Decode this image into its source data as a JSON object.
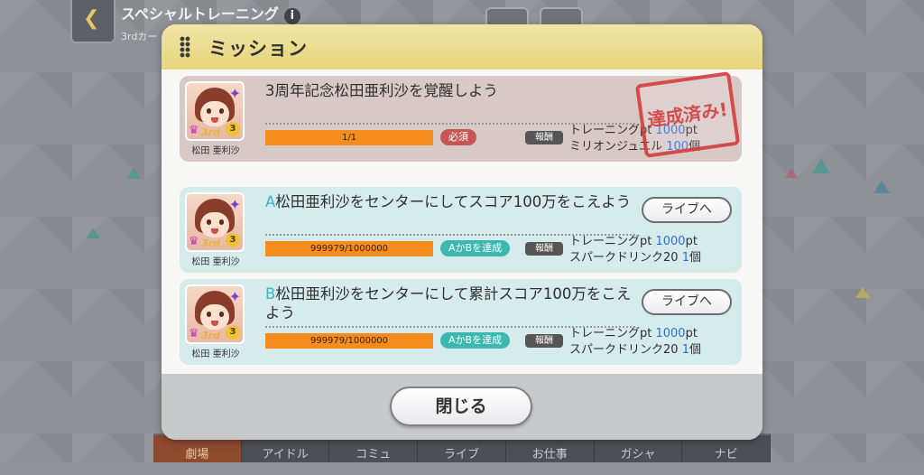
{
  "background": {
    "title": "スペシャルトレーニング",
    "subtitle": "3rdカー",
    "nav": [
      "劇場",
      "アイドル",
      "コミュ",
      "ライブ",
      "お仕事",
      "ガシャ",
      "ナビ"
    ]
  },
  "dialog": {
    "title": "ミッション",
    "close_label": "閉じる",
    "missions": [
      {
        "letter": "",
        "title": "3周年記念松田亜利沙を覚醒しよう",
        "idol_name": "松田 亜利沙",
        "progress_text": "1/1",
        "condition": "必須",
        "reward_label": "報酬",
        "reward_line1_text": "トレーニングpt ",
        "reward_line1_value": "1000",
        "reward_line1_unit": "pt",
        "reward_line2_text": "ミリオンジュエル ",
        "reward_line2_value": "100",
        "reward_line2_unit": "個",
        "stamp": "達成済み!"
      },
      {
        "letter": "A",
        "title": "松田亜利沙をセンターにしてスコア100万をこえよう",
        "idol_name": "松田 亜利沙",
        "progress_text": "999979/1000000",
        "condition": "AかBを達成",
        "reward_label": "報酬",
        "reward_line1_text": "トレーニングpt ",
        "reward_line1_value": "1000",
        "reward_line1_unit": "pt",
        "reward_line2_text": "スパークドリンク20 ",
        "reward_line2_value": "1",
        "reward_line2_unit": "個",
        "button": "ライブへ"
      },
      {
        "letter": "B",
        "title": "松田亜利沙をセンターにして累計スコア100万をこえよう",
        "idol_name": "松田 亜利沙",
        "progress_text": "999979/1000000",
        "condition": "AかBを達成",
        "reward_label": "報酬",
        "reward_line1_text": "トレーニングpt ",
        "reward_line1_value": "1000",
        "reward_line1_unit": "pt",
        "reward_line2_text": "スパークドリンク20 ",
        "reward_line2_value": "1",
        "reward_line2_unit": "個",
        "button": "ライブへ"
      }
    ]
  },
  "colors": {
    "header": "#e6d57c",
    "done_card": "#d8c9c7",
    "open_card": "#d6ebec",
    "progress": "#f58c1e",
    "required": "#c65656",
    "either": "#3db8b0",
    "value_blue": "#2b6fd6",
    "stamp_red": "#d43a3a"
  }
}
